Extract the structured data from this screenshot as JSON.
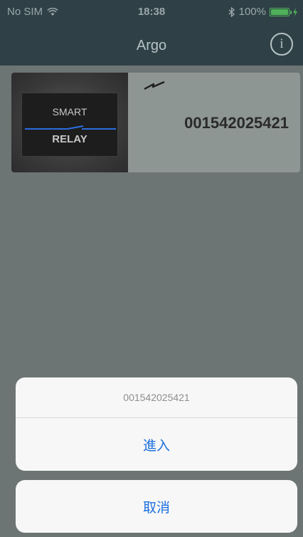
{
  "status_bar": {
    "carrier": "No SIM",
    "time": "18:38",
    "battery": "100%",
    "battery_level": 1.0,
    "icons": [
      "wifi-icon",
      "bluetooth-icon",
      "battery-icon",
      "charging-icon"
    ]
  },
  "nav": {
    "title": "Argo",
    "info_icon": "info-icon",
    "info_glyph": "i"
  },
  "device": {
    "image_text_top": "SMART",
    "image_text_bottom": "RELAY",
    "id": "001542025421",
    "status_icon": "lightning-icon"
  },
  "action_sheet": {
    "title": "001542025421",
    "enter_label": "進入",
    "cancel_label": "取消"
  },
  "colors": {
    "nav_background": "#2f4147",
    "accent_blue": "#1c6edf",
    "battery_green": "#4fb15a",
    "overlay": "#6d7474"
  }
}
